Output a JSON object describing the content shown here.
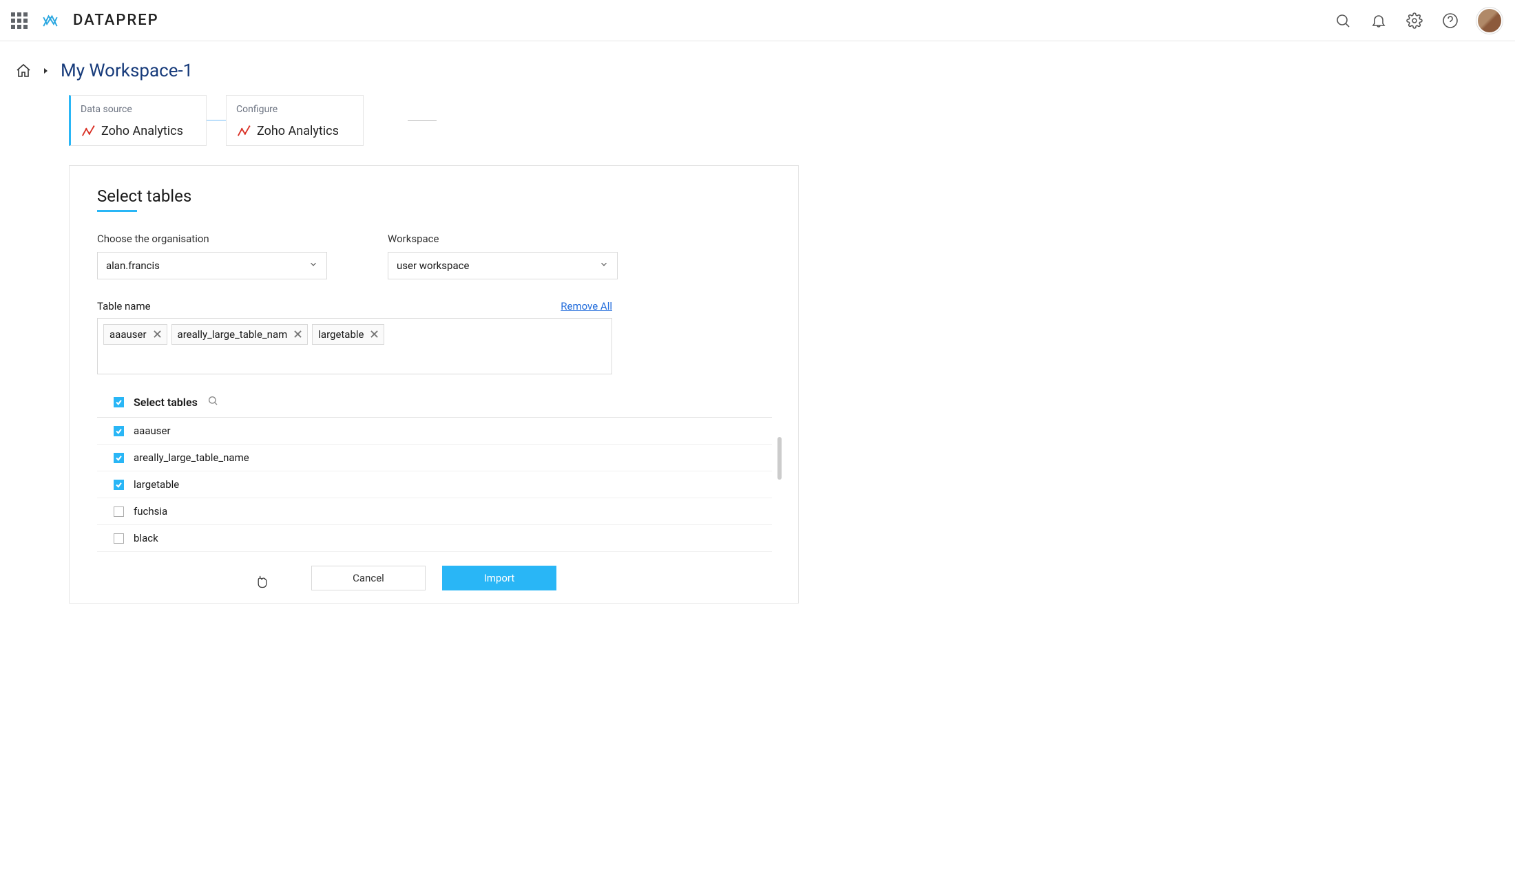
{
  "app": {
    "name": "DATAPREP"
  },
  "breadcrumb": {
    "workspace": "My Workspace-1"
  },
  "steps": {
    "datasource": {
      "title": "Data source",
      "value": "Zoho Analytics"
    },
    "configure": {
      "title": "Configure",
      "value": "Zoho Analytics"
    }
  },
  "panel": {
    "title": "Select tables",
    "org_label": "Choose the organisation",
    "org_value": "alan.francis",
    "workspace_label": "Workspace",
    "workspace_value": "user workspace",
    "tablename_label": "Table name",
    "remove_all": "Remove All",
    "tags": [
      {
        "name": "aaauser"
      },
      {
        "name": "areally_large_table_nam"
      },
      {
        "name": "largetable"
      }
    ],
    "list_header": "Select tables",
    "tables": [
      {
        "name": "aaauser",
        "checked": true
      },
      {
        "name": "areally_large_table_name",
        "checked": true
      },
      {
        "name": "largetable",
        "checked": true
      },
      {
        "name": "fuchsia",
        "checked": false
      },
      {
        "name": "black",
        "checked": false
      }
    ],
    "cancel": "Cancel",
    "import": "Import"
  }
}
